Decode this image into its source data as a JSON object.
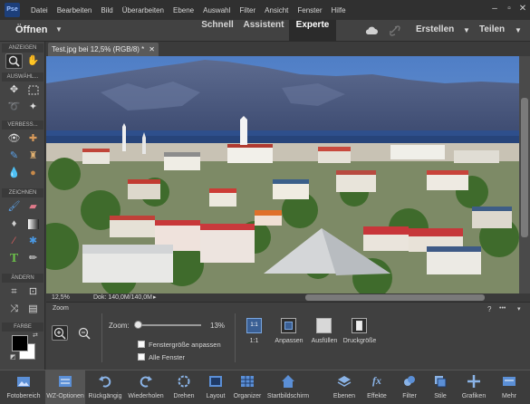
{
  "menu": [
    "Datei",
    "Bearbeiten",
    "Bild",
    "Überarbeiten",
    "Ebene",
    "Auswahl",
    "Filter",
    "Ansicht",
    "Fenster",
    "Hilfe"
  ],
  "logo_text": "Pse",
  "modebar": {
    "open_label": "Öffnen",
    "modes": [
      "Schnell",
      "Assistent",
      "Experte"
    ],
    "active_mode": "Experte",
    "create_label": "Erstellen",
    "share_label": "Teilen"
  },
  "toolbar": {
    "sections": [
      "ANZEIGEN",
      "AUSWÄHL...",
      "VERBESS...",
      "ZEICHNEN",
      "ÄNDERN",
      "FARBE"
    ],
    "foreground_color": "#000000",
    "background_color": "#ffffff"
  },
  "document": {
    "tab_title": "Test.jpg bei 12,5% (RGB/8) *",
    "zoom_status": "12,5%",
    "doc_status": "Dok: 140,0M/140,0M"
  },
  "options": {
    "tool_name": "Zoom",
    "zoom_label": "Zoom:",
    "zoom_value": "13%",
    "zoom_percent": 13,
    "resize_windows_label": "Fenstergröße anpassen",
    "all_windows_label": "Alle Fenster",
    "view_buttons": [
      "1:1",
      "Anpassen",
      "Ausfüllen",
      "Druckgröße"
    ]
  },
  "bottombar": {
    "left": [
      "Fotobereich",
      "WZ-Optionen",
      "Rückgängig",
      "Wiederholen",
      "Drehen",
      "Layout",
      "Organizer",
      "Startbildschirm"
    ],
    "right": [
      "Ebenen",
      "Effekte",
      "Filter",
      "Stile",
      "Grafiken",
      "Mehr"
    ]
  },
  "colors": {
    "accent": "#2b2b2b",
    "panel": "#404040"
  }
}
